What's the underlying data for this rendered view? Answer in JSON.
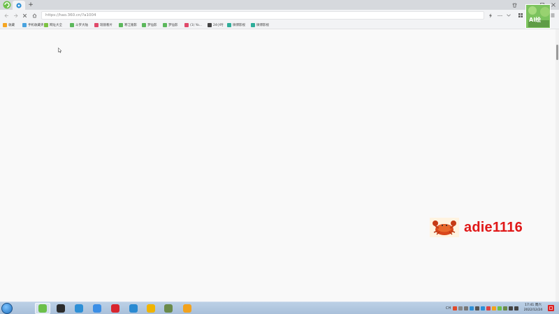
{
  "browser": {
    "new_tab_label": "+",
    "url": "https://hao.360.cn/?a1004"
  },
  "bookmarks": [
    {
      "name": "bm-favorites",
      "label": "收藏",
      "color": "#f5a623"
    },
    {
      "name": "bm-phone-favorites",
      "label": "手机收藏夹",
      "color": "#4aa3df"
    },
    {
      "name": "bm-site-directory",
      "label": "网址大全",
      "color": "#7cc242"
    },
    {
      "name": "bm-link-1",
      "label": "斗罗大陆",
      "color": "#5cb85c"
    },
    {
      "name": "bm-link-2",
      "label": "瑞丽看片",
      "color": "#e04a6a"
    },
    {
      "name": "bm-link-3",
      "label": "寒江雁影",
      "color": "#5cb85c"
    },
    {
      "name": "bm-link-4",
      "label": "梦仙影",
      "color": "#5cb85c"
    },
    {
      "name": "bm-link-5",
      "label": "梦仙影",
      "color": "#5cb85c"
    },
    {
      "name": "bm-link-6",
      "label": "(1) Yo...",
      "color": "#e04a6a"
    },
    {
      "name": "bm-link-7",
      "label": "24小时",
      "color": "#444444"
    },
    {
      "name": "bm-link-8",
      "label": "微博影视",
      "color": "#2fae9a"
    },
    {
      "name": "bm-link-9",
      "label": "微博影视",
      "color": "#2fae9a"
    }
  ],
  "watermark": {
    "text": "adie1116",
    "color": "#e01818"
  },
  "avatar": {
    "label": "AI绘"
  },
  "taskbar": {
    "apps": [
      {
        "name": "taskbar-360-browser",
        "color": "#6cc04a",
        "active": true
      },
      {
        "name": "taskbar-obs",
        "color": "#2b2b2b",
        "active": false
      },
      {
        "name": "taskbar-edge",
        "color": "#2d8fd6",
        "active": false
      },
      {
        "name": "taskbar-feishu",
        "color": "#3a8ee6",
        "active": false
      },
      {
        "name": "taskbar-netease-music",
        "color": "#d8252e",
        "active": false
      },
      {
        "name": "taskbar-app-blue",
        "color": "#2a8ad2",
        "active": false
      },
      {
        "name": "taskbar-app-owl",
        "color": "#f0b400",
        "active": false
      },
      {
        "name": "taskbar-app-game",
        "color": "#6a8a4a",
        "active": false
      },
      {
        "name": "taskbar-app-orange",
        "color": "#f2a21e",
        "active": false
      }
    ],
    "lang_label": "CH",
    "time": "17:41 周六",
    "date": "2022/12/24"
  }
}
